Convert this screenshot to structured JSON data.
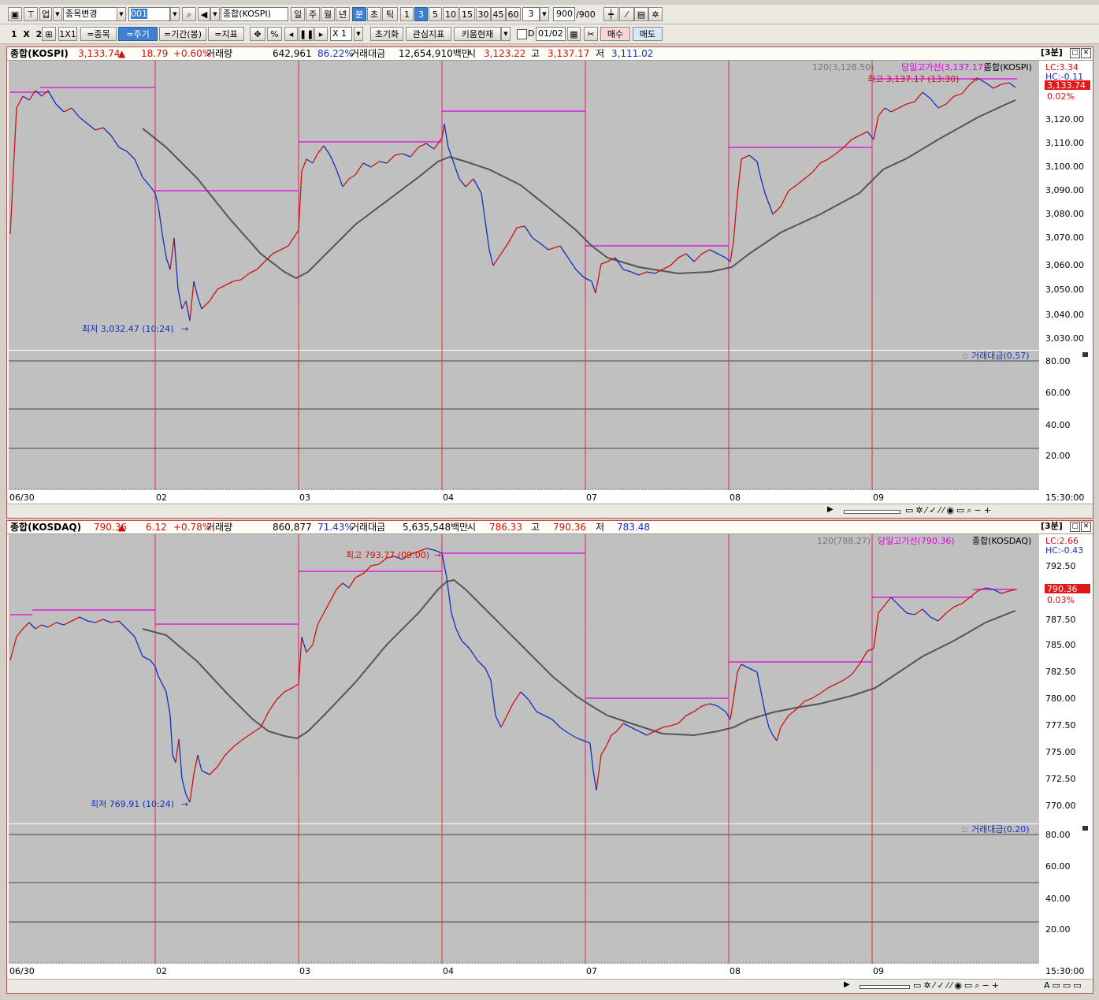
{
  "toolbar1": {
    "market_label": "업",
    "symbol_change": "종목변경",
    "code_value": "001",
    "symbol_name": "종합(KOSPI)",
    "periods": [
      "일",
      "주",
      "월",
      "년",
      "분",
      "초",
      "틱"
    ],
    "period_selected": "분",
    "intervals": [
      "1",
      "3",
      "5",
      "10",
      "15",
      "30",
      "45",
      "60"
    ],
    "interval_selected": "3",
    "interval_value": "3",
    "count": "900",
    "count_total": "/900"
  },
  "toolbar2": {
    "layout_1": "1",
    "layout_x": "X",
    "layout_2": "2",
    "layout_1x1": "1X1",
    "btn_symbol": "=종목",
    "btn_period": "=주기",
    "btn_range": "=기간(봉)",
    "btn_indicator": "=지표",
    "pct": "%",
    "zoom": "X 1",
    "btn_reset": "초기화",
    "btn_watch": "관심지표",
    "btn_kiwoom": "키움현재",
    "date_value": "01/02",
    "btn_buy": "매수",
    "btn_sell": "매도"
  },
  "panels": [
    {
      "name": "종합(KOSPI)",
      "price": "3,133.74",
      "change": "18.79",
      "change_pct": "+0.60%",
      "vol_label": "거래량",
      "volume": "642,961",
      "vol_pct": "86.22%",
      "amt_label": "거래대금",
      "amount": "12,654,910백만",
      "open_label": "시",
      "open": "3,123.22",
      "high_label": "고",
      "high": "3,137.17",
      "low_label": "저",
      "low": "3,111.02",
      "period_tag": "[3분]",
      "ma_label": "120(3,128.50)",
      "dayhigh_label": "당일고가선(3,137.17)",
      "symbol_tag": "종합(KOSPI)",
      "lc": "LC:3.34",
      "hc": "HC:-0.11",
      "last_price": "3,133.74",
      "last_pct": "0.02%",
      "max_label": "최고 3,137.17 (13:30)",
      "min_label": "최저 3,032.47 (10:24)",
      "sub_label": "거래대금(0.57)",
      "y_ticks": [
        "3,120.00",
        "3,110.00",
        "3,100.00",
        "3,090.00",
        "3,080.00",
        "3,070.00",
        "3,060.00",
        "3,050.00",
        "3,040.00",
        "3,030.00"
      ],
      "sub_ticks": [
        "80.00",
        "60.00",
        "40.00",
        "20.00"
      ],
      "x_labels": [
        "06/30",
        "02",
        "03",
        "04",
        "07",
        "08",
        "09"
      ],
      "time_label": "15:30:00"
    },
    {
      "name": "종합(KOSDAQ)",
      "price": "790.36",
      "change": "6.12",
      "change_pct": "+0.78%",
      "vol_label": "거래량",
      "volume": "860,877",
      "vol_pct": "71.43%",
      "amt_label": "거래대금",
      "amount": "5,635,548백만",
      "open_label": "시",
      "open": "786.33",
      "high_label": "고",
      "high": "790.36",
      "low_label": "저",
      "low": "783.48",
      "period_tag": "[3분]",
      "ma_label": "120(788.27)",
      "dayhigh_label": "당일고가선(790.36)",
      "symbol_tag": "종합(KOSDAQ)",
      "lc": "LC:2.66",
      "hc": "HC:-0.43",
      "last_price": "790.36",
      "last_pct": "0.03%",
      "max_label": "최고 793.77 (09:00)",
      "min_label": "최저 769.91 (10:24)",
      "sub_label": "거래대금(0.20)",
      "y_ticks": [
        "792.50",
        "787.50",
        "785.00",
        "782.50",
        "780.00",
        "777.50",
        "775.00",
        "772.50",
        "770.00"
      ],
      "sub_ticks": [
        "80.00",
        "60.00",
        "40.00",
        "20.00"
      ],
      "x_labels": [
        "06/30",
        "02",
        "03",
        "04",
        "07",
        "08",
        "09"
      ],
      "time_label": "15:30:00"
    }
  ],
  "colors": {
    "up": "#d01010",
    "down": "#1030c0",
    "dayhigh": "#e000e0",
    "ma": "#555555",
    "plot_bg": "#c0c0c0",
    "day_sep": "#e03030"
  }
}
